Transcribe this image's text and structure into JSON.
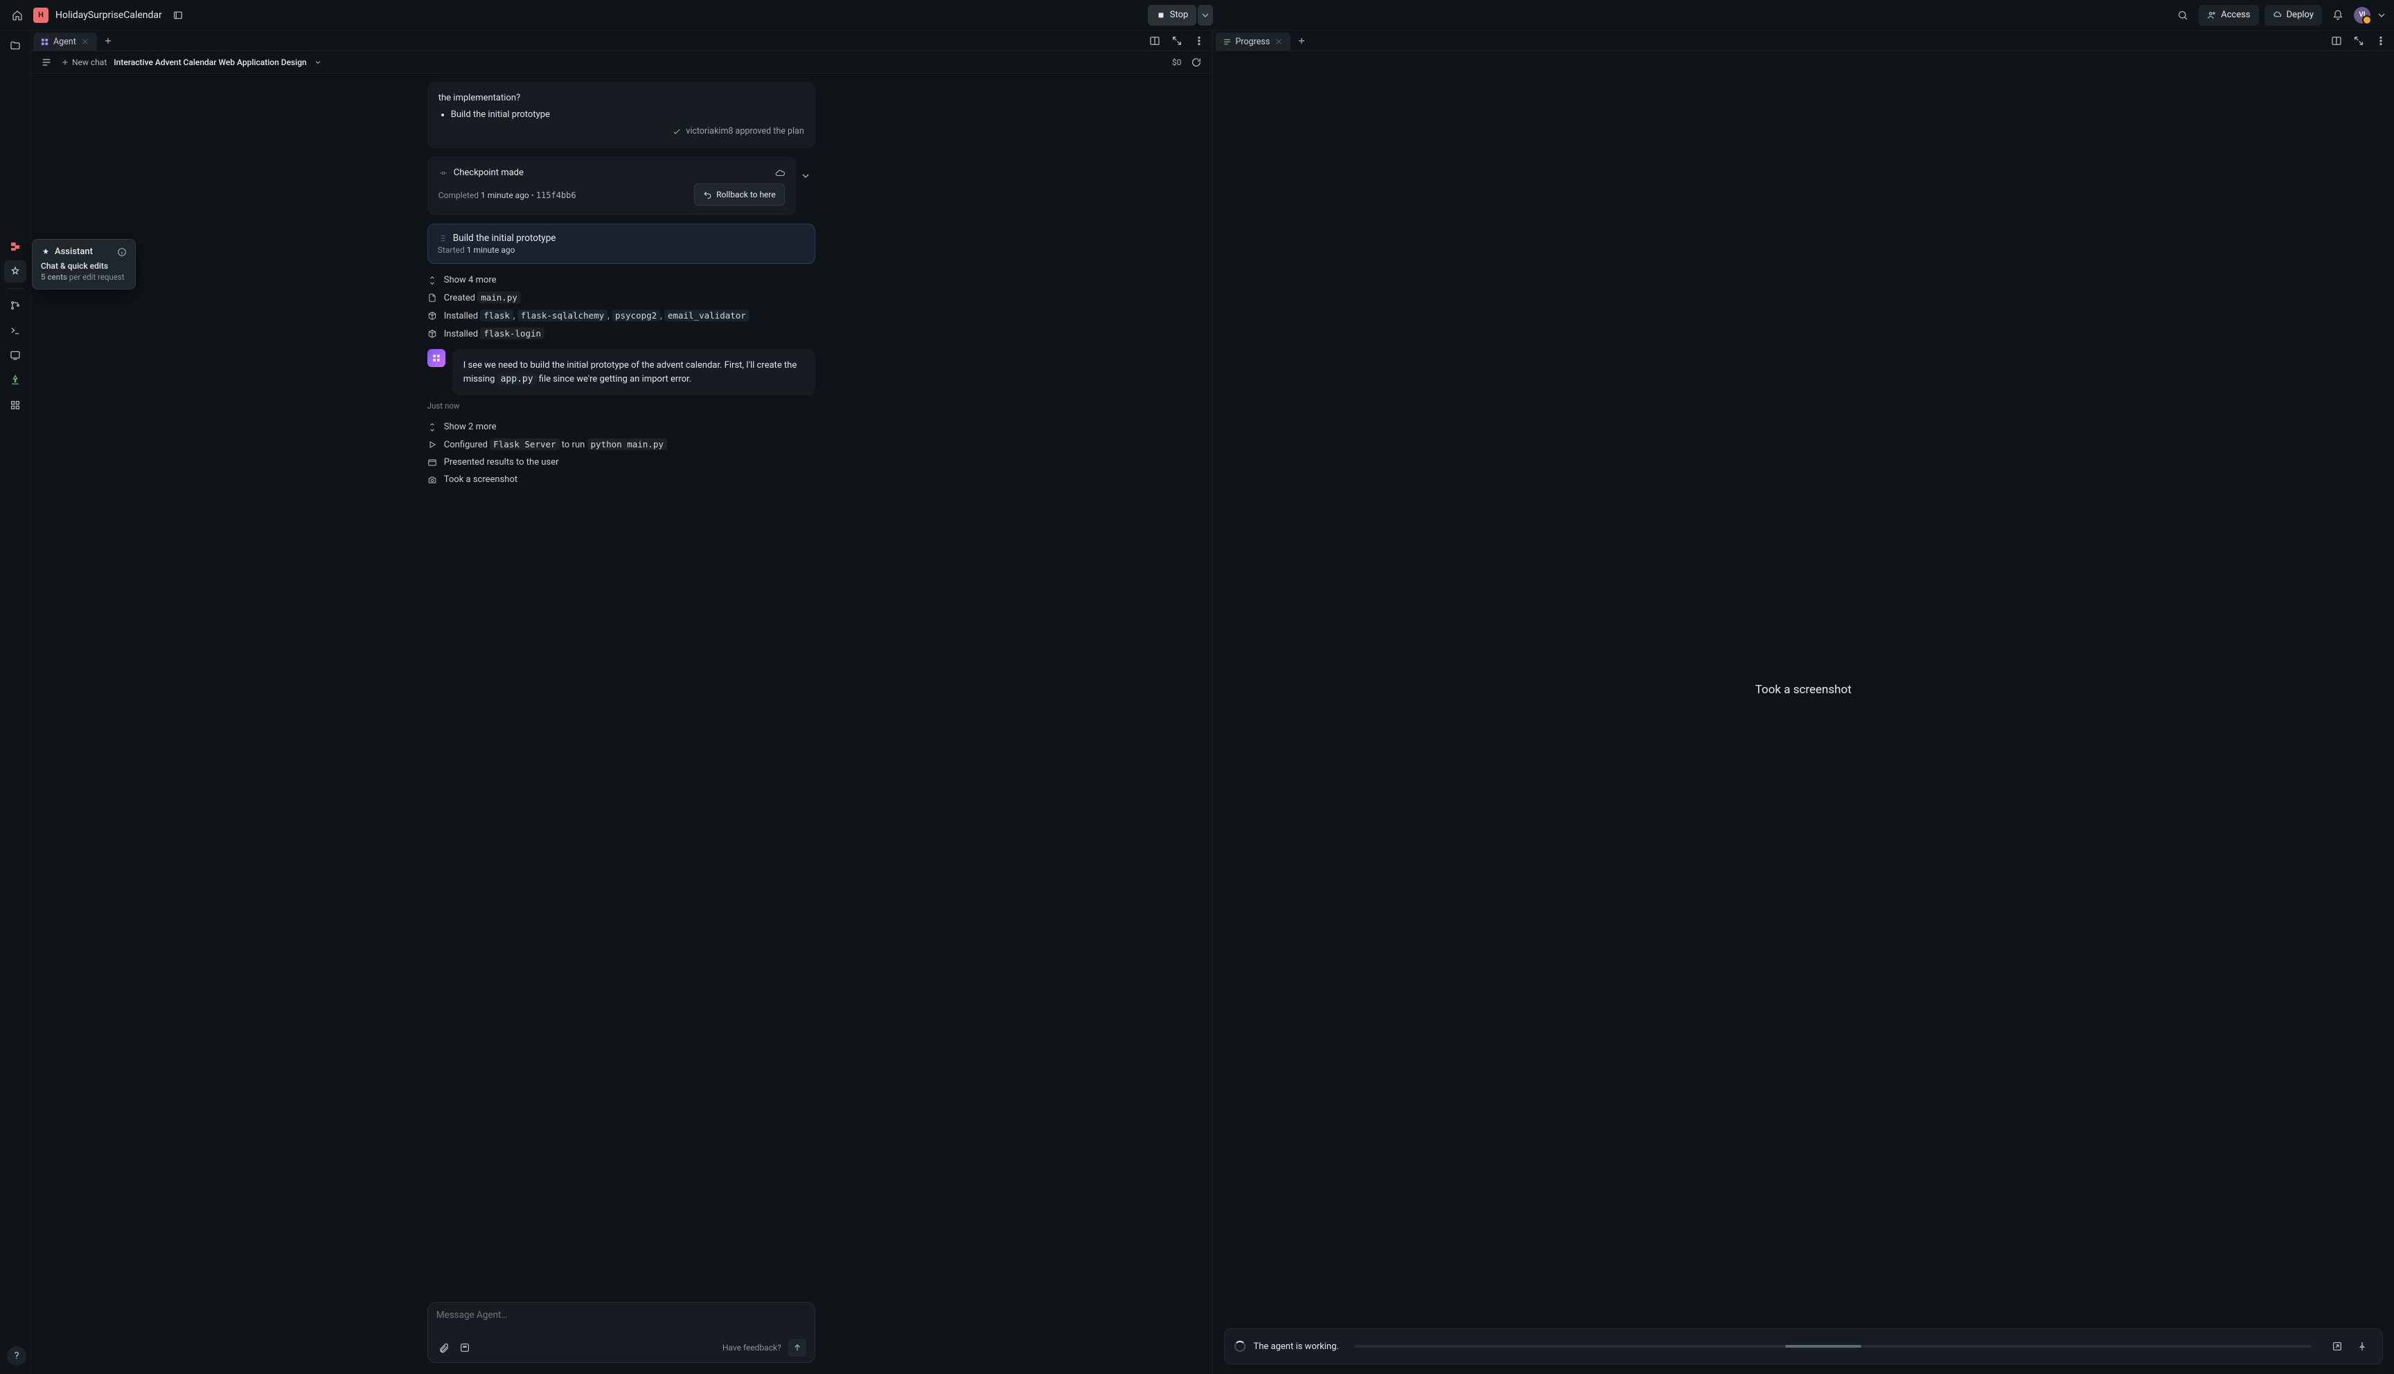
{
  "project": {
    "name": "HolidaySurpriseCalendar",
    "badge": "H"
  },
  "topbar": {
    "stop_label": "Stop",
    "access_label": "Access",
    "deploy_label": "Deploy",
    "avatar_initials": "VI"
  },
  "pane_agent": {
    "tab_label": "Agent",
    "subbar": {
      "new_chat": "New chat",
      "thread_title": "Interactive Advent Calendar Web Application Design",
      "cost": "$0"
    }
  },
  "pane_progress": {
    "tab_label": "Progress",
    "center_text": "Took a screenshot",
    "status_text": "The agent is working."
  },
  "chat": {
    "plan_tail": "the implementation?",
    "plan_bullet": "Build the initial prototype",
    "approved_by": "victoriakim8 approved the plan",
    "checkpoint": {
      "title": "Checkpoint made",
      "completed_label": "Completed",
      "completed_time": "1 minute ago",
      "bullet": "•",
      "hash": "115f4bb6",
      "rollback_label": "Rollback to here"
    },
    "task": {
      "title": "Build the initial prototype",
      "started_label": "Started",
      "started_time": "1 minute ago"
    },
    "steps1": {
      "show_more": "Show 4 more",
      "created_prefix": "Created",
      "created_file": "main.py",
      "installed1_prefix": "Installed",
      "pkg_flask": "flask",
      "pkg_sa": "flask-sqlalchemy",
      "pkg_pg": "psycopg2",
      "pkg_ev": "email_validator",
      "installed2_prefix": "Installed",
      "pkg_login": "flask-login"
    },
    "assistant_msg_pre": "I see we need to build the initial prototype of the advent calendar. First, I'll create the missing ",
    "assistant_code": "app.py",
    "assistant_msg_post": " file since we're getting an import error.",
    "just_now": "Just now",
    "steps2": {
      "show_more": "Show 2 more",
      "configured_prefix": "Configured",
      "server_name": "Flask Server",
      "to_run": " to run ",
      "run_cmd": "python main.py",
      "presented": "Presented results to the user",
      "screenshot": "Took a screenshot"
    }
  },
  "composer": {
    "placeholder": "Message Agent…",
    "feedback": "Have feedback?"
  },
  "tooltip": {
    "title": "Assistant",
    "subtitle": "Chat & quick edits",
    "price_bold": "5 cents",
    "price_rest": " per edit request"
  }
}
